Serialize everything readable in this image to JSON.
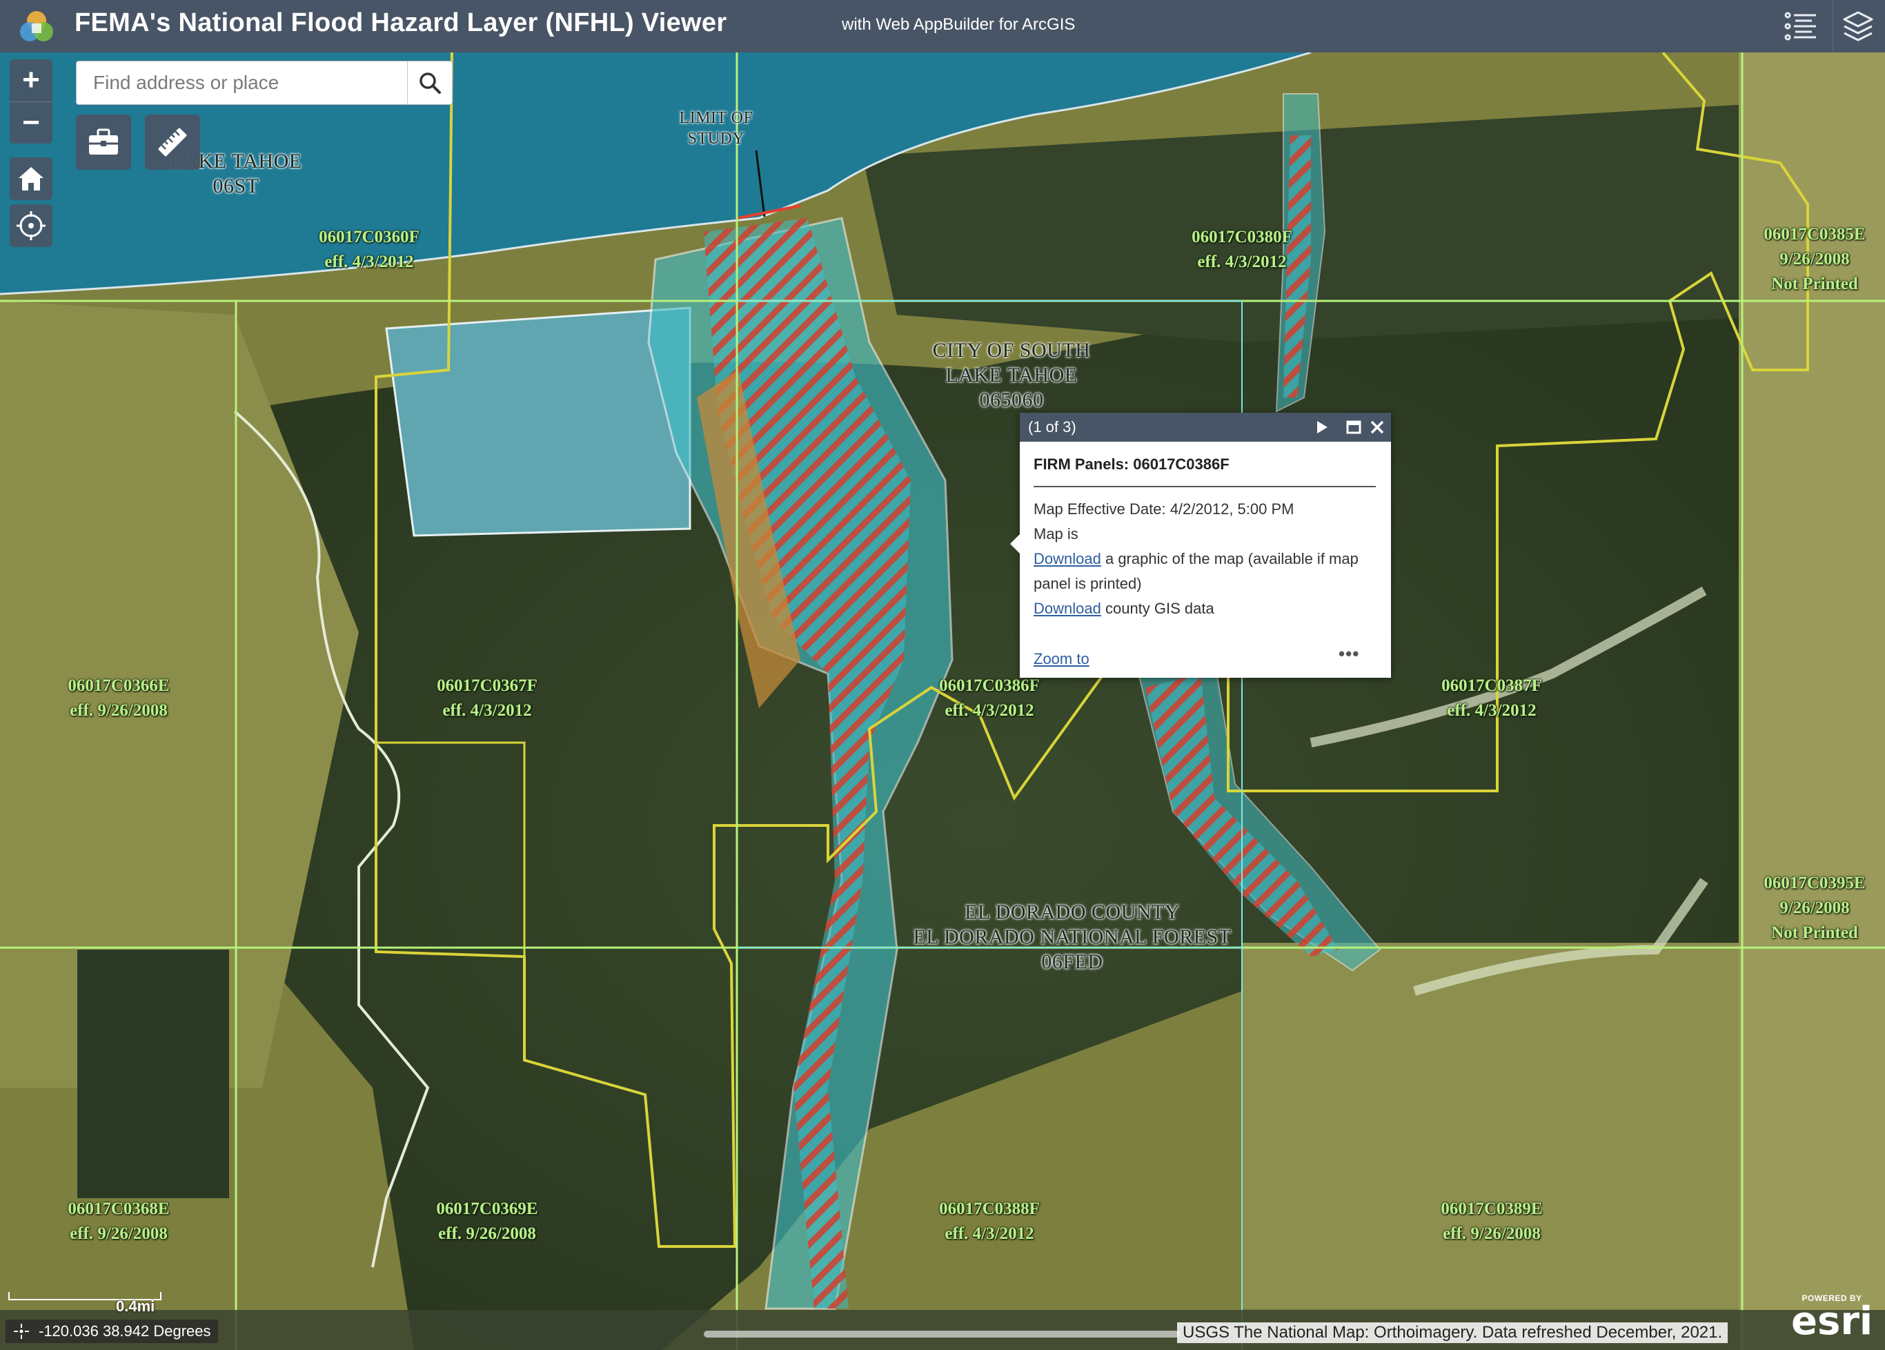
{
  "header": {
    "title": "FEMA's National Flood Hazard Layer (NFHL) Viewer",
    "subtitle": "with Web AppBuilder for ArcGIS"
  },
  "search": {
    "placeholder": "Find address or place"
  },
  "zoom": {
    "in_label": "+",
    "out_label": "−"
  },
  "panels": [
    {
      "id": "06017C0360F",
      "eff": "eff. 4/3/2012"
    },
    {
      "id": "06017C0380F",
      "eff": "eff. 4/3/2012"
    },
    {
      "id": "06017C0385E",
      "eff": "9/26/2008",
      "note": "Not Printed"
    },
    {
      "id": "06017C0366E",
      "eff": "eff. 9/26/2008"
    },
    {
      "id": "06017C0367F",
      "eff": "eff. 4/3/2012"
    },
    {
      "id": "06017C0386F",
      "eff": "eff. 4/3/2012"
    },
    {
      "id": "06017C0387F",
      "eff": "eff. 4/3/2012"
    },
    {
      "id": "06017C0395E",
      "eff": "9/26/2008",
      "note": "Not Printed"
    },
    {
      "id": "06017C0368E",
      "eff": "eff. 9/26/2008"
    },
    {
      "id": "06017C0369E",
      "eff": "eff. 9/26/2008"
    },
    {
      "id": "06017C0388F",
      "eff": "eff. 4/3/2012"
    },
    {
      "id": "06017C0389E",
      "eff": "eff. 9/26/2008"
    }
  ],
  "places": {
    "lake_tahoe": {
      "line1": "LAKE TAHOE",
      "line2": "06ST"
    },
    "limit_of_study": {
      "line1": "LIMIT OF",
      "line2": "STUDY"
    },
    "south_lake_tahoe": {
      "line1": "CITY OF SOUTH",
      "line2": "LAKE TAHOE",
      "line3": "065060"
    },
    "el_dorado": {
      "line1": "EL DORADO COUNTY",
      "line2": "EL DORADO NATIONAL FOREST",
      "line3": "06FED"
    }
  },
  "popup": {
    "count": "(1 of 3)",
    "title": "FIRM Panels: 06017C0386F",
    "effective_date": "Map Effective Date: 4/2/2012, 5:00 PM",
    "map_is": "Map is",
    "download_link": "Download",
    "graphic_text": "a graphic of the map (available if map panel is printed)",
    "download_link_2": "Download",
    "gis_text": "county GIS data",
    "zoom_to": "Zoom to",
    "more": "•••"
  },
  "footer": {
    "scale": "0.4mi",
    "coordinates": "-120.036 38.942 Degrees",
    "attribution": "USGS The National Map: Orthoimagery. Data refreshed December, 2021.",
    "esri_powered": "POWERED BY",
    "esri_word": "esri"
  },
  "colors": {
    "header_bg": "#485566",
    "panel_label": "#b8f08a",
    "panel_grid": "#b6f27a",
    "community_boundary": "#d9d43a",
    "flood_zone_ae": "#3fbcc4",
    "floodway_hatch": "#d4402e",
    "lake": "#1f7a94"
  }
}
